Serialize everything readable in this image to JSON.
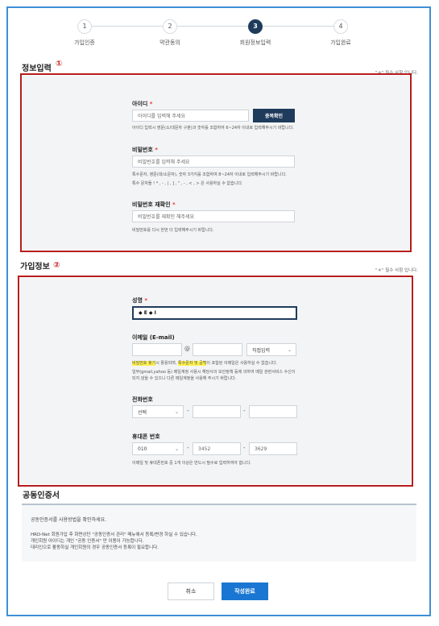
{
  "steps": [
    {
      "num": "1",
      "label": "가입인증"
    },
    {
      "num": "2",
      "label": "약관동의"
    },
    {
      "num": "3",
      "label": "회원정보입력"
    },
    {
      "num": "4",
      "label": "가입완료"
    }
  ],
  "required_note": "\"＊\" 필수 사항 입니다.",
  "section1": {
    "title": "정보입력",
    "badge": "①",
    "id_label": "아이디",
    "id_placeholder": "아이디를 입력해 주세요",
    "dup_check": "중복확인",
    "id_help": "아이디 입력시 영문(소/대문자 구분)과 숫자를 조합하여 6~24자 이내로 입력해주시기 바랍니다.",
    "pw_label": "비밀번호",
    "pw_placeholder": "비밀번호를 입력해 주세요",
    "pw_help1": "특수문자, 영문(대/소문자), 숫자 3가지를 조합하여 8~24자 이내로 입력해주시기 바랍니다.",
    "pw_help2": "특수 문자들 ! * , - , | , ] , \" , - , < , > 은 사용하실 수 없습니다.",
    "pw2_label": "비밀번호 재확인",
    "pw2_placeholder": "비밀번호를 재확인 해주세요",
    "pw2_help": "비밀번호를 다시 한번 더 입력해주시기 바랍니다."
  },
  "section2": {
    "title": "가입정보",
    "badge": "②",
    "name_label": "성명",
    "name_value": "◆ E ◆ I",
    "email_label": "이메일 (E-mail)",
    "email_at": "@",
    "email_domain_select": "직접입력",
    "email_help1_hl1": "비밀번호 찾기",
    "email_help1_mid": "시 활용되며, ",
    "email_help1_hl2": "특수문자 및 공백",
    "email_help1_end": "이 포함된 이메일은 사용하실 수 없습니다.",
    "email_help2": "일부(gmail,yahoo 등) 메일계정 사용시 해당사의 보안정책 등에 의하여 메일 관련서비스 수신이",
    "email_help3": "되지 않을 수 있으니 다른 메일계정을 사용해 주시기 바랍니다.",
    "phone_label": "전화번호",
    "phone_select": "선택",
    "dash": "-",
    "mobile_label": "휴대폰 번호",
    "mobile_prefix": "010",
    "mobile_mid": "3452",
    "mobile_last": "3629",
    "contact_help": "이메일 및 휴대폰번호 중 1개 이상은 반드시 필수로 입력하여야 합니다."
  },
  "cert": {
    "title": "공동인증서",
    "line1": "공동인증서를 사용방법을 확인하세요.",
    "line2": "HRD-Net 회원가입 후 화면상단 \"공동인증서 관리\" 메뉴에서 등록/변경 하실 수 있습니다.",
    "line3": "개인회원 아이디는 개인 \"공동 인증서\" 만 이용이 가능합니다.",
    "line4": "대리인으로 활동하실 개인회원의 경우 공동인증서 등록이 필요합니다."
  },
  "buttons": {
    "cancel": "취소",
    "submit": "작성완료"
  },
  "colors": {
    "primary": "#1976d2",
    "dark_navy": "#1f3b5c",
    "annotation_red": "#b71c1c",
    "highlight": "#fff34d",
    "frame_blue": "#3e8fd6"
  }
}
